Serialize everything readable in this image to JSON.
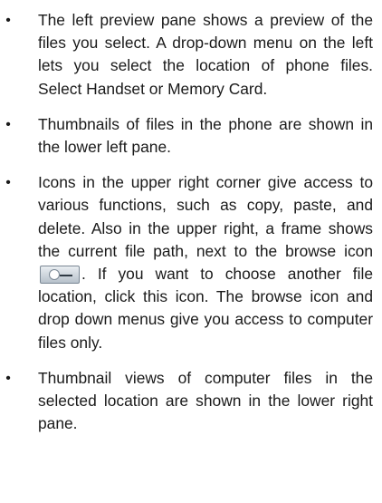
{
  "bullets": [
    {
      "marker": "•",
      "text": "The left preview pane shows a preview of the files you select. A drop-down menu on the left lets you select the location of phone files. Select Handset or Memory Card."
    },
    {
      "marker": "•",
      "text": "Thumbnails of files in the phone are shown in the lower left pane."
    },
    {
      "marker": "•",
      "text_before_icon": "Icons in the upper right corner give access to various functions, such as copy, paste, and delete. Also in the upper right, a frame shows the current file path, next to the browse icon",
      "icon": "browse-icon",
      "text_after_icon": ". If you want to choose another file location, click this icon. The browse icon and drop down menus give you access to computer files only."
    },
    {
      "marker": "•",
      "text": "Thumbnail views of computer files in the selected location are shown in the lower right pane."
    }
  ]
}
